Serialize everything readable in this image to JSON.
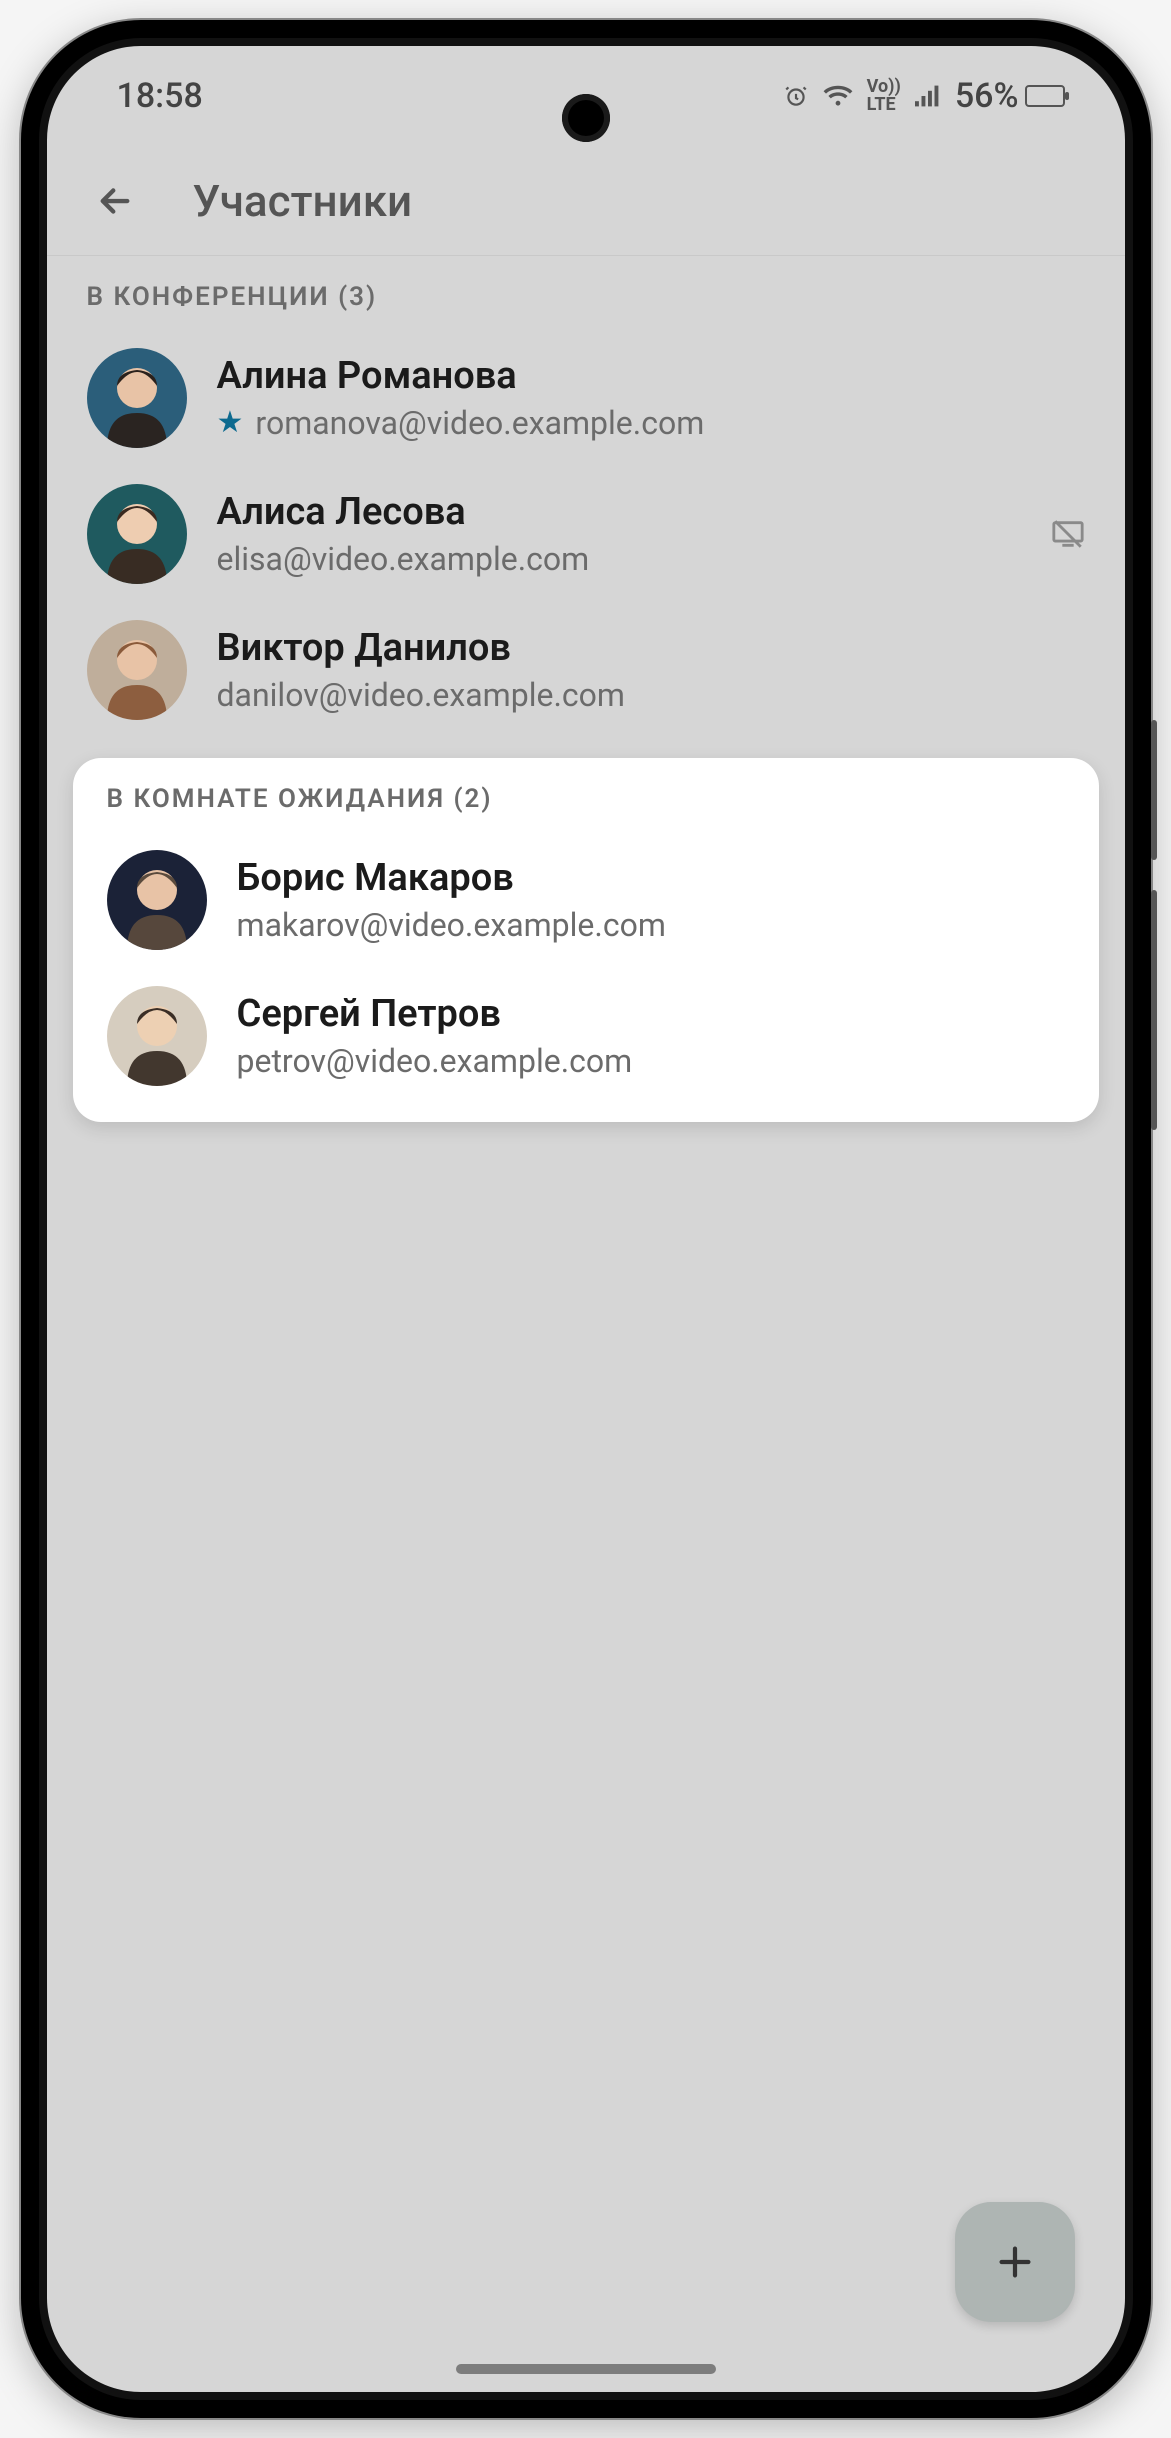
{
  "status": {
    "time": "18:58",
    "battery_pct": "56%"
  },
  "header": {
    "title": "Участники"
  },
  "sections": {
    "conference": {
      "label": "В КОНФЕРЕНЦИИ (3)"
    },
    "waiting": {
      "label": "В КОМНАТЕ ОЖИДАНИЯ (2)"
    }
  },
  "participants": {
    "in_conference": [
      {
        "name": "Алина Романова",
        "email": "romanova@video.example.com",
        "is_host": true,
        "no_share": false
      },
      {
        "name": "Алиса Лесова",
        "email": "elisa@video.example.com",
        "is_host": false,
        "no_share": true
      },
      {
        "name": "Виктор Данилов",
        "email": "danilov@video.example.com",
        "is_host": false,
        "no_share": false
      }
    ],
    "waiting": [
      {
        "name": "Борис Макаров",
        "email": "makarov@video.example.com"
      },
      {
        "name": "Сергей Петров",
        "email": "petrov@video.example.com"
      }
    ]
  },
  "avatars": {
    "romanova": {
      "bg": "#2b5e7a",
      "skin": "#e8c3a6",
      "hair": "#2a211c"
    },
    "lesova": {
      "bg": "#1f5a5f",
      "skin": "#eecdb1",
      "hair": "#3a2a20"
    },
    "danilov": {
      "bg": "#bfae9b",
      "skin": "#e8c3a6",
      "hair": "#8a5a3a"
    },
    "makarov": {
      "bg": "#1b2237",
      "skin": "#e8c3a6",
      "hair": "#5a4a3c"
    },
    "petrov": {
      "bg": "#d6cdbf",
      "skin": "#edd0b3",
      "hair": "#3a2e26"
    }
  }
}
